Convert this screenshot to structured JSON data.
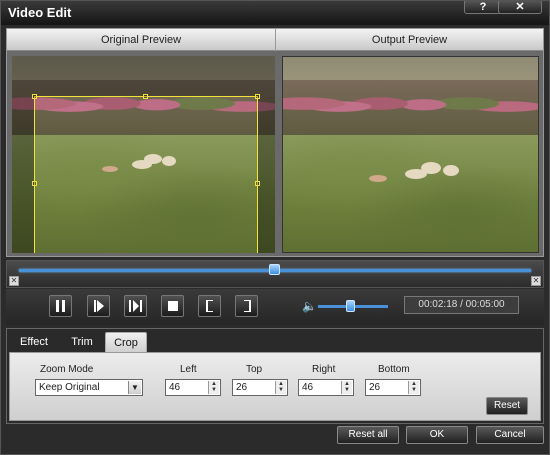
{
  "window": {
    "title": "Video Edit",
    "help_label": "?",
    "close_label": "✕"
  },
  "preview": {
    "original_label": "Original Preview",
    "output_label": "Output Preview"
  },
  "playback": {
    "progress_fraction": 0.5,
    "volume_fraction": 0.45,
    "time_display": "00:02:18 / 00:05:00",
    "buttons": [
      "pause",
      "next-frame",
      "step",
      "stop",
      "mark-in",
      "mark-out"
    ]
  },
  "tabs": [
    {
      "label": "Effect",
      "active": false
    },
    {
      "label": "Trim",
      "active": false
    },
    {
      "label": "Crop",
      "active": true
    }
  ],
  "crop": {
    "zoom_mode_label": "Zoom Mode",
    "zoom_mode_value": "Keep Original",
    "left_label": "Left",
    "left_value": "46",
    "top_label": "Top",
    "top_value": "26",
    "right_label": "Right",
    "right_value": "46",
    "bottom_label": "Bottom",
    "bottom_value": "26",
    "reset_label": "Reset"
  },
  "footer": {
    "reset_all_label": "Reset all",
    "ok_label": "OK",
    "cancel_label": "Cancel"
  },
  "colors": {
    "accent": "#4a90d9",
    "crop_border": "#f2e23a"
  }
}
